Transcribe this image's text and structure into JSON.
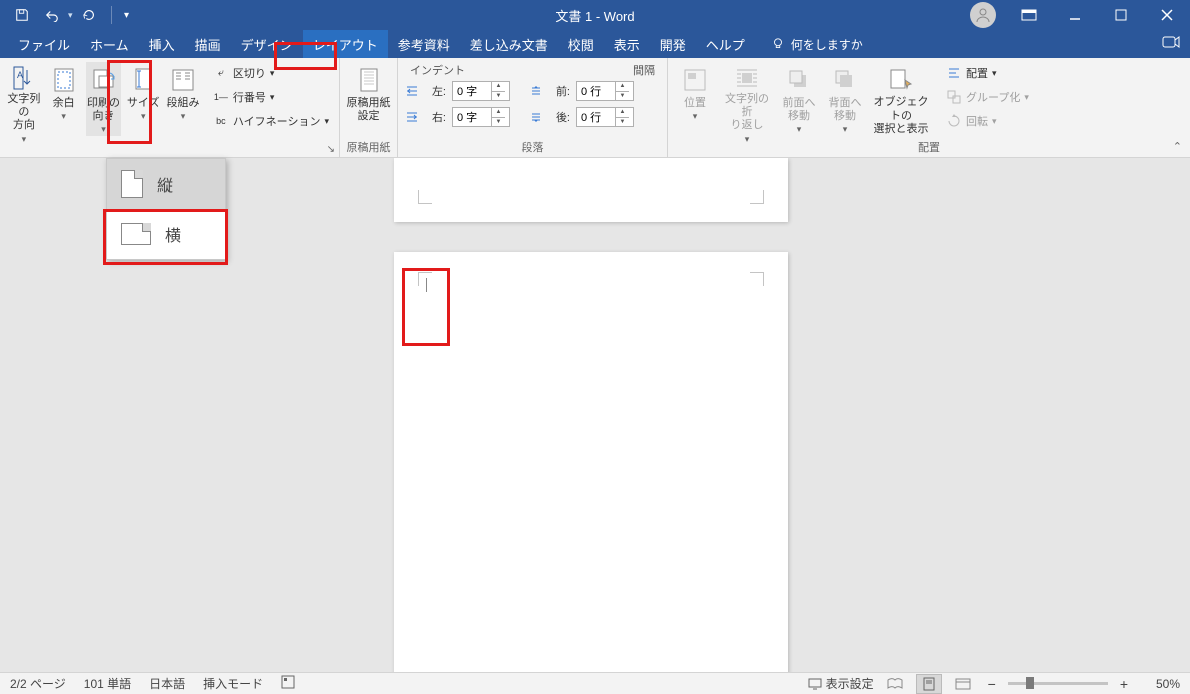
{
  "title": "文書 1  -  Word",
  "tabs": {
    "file": "ファイル",
    "home": "ホーム",
    "insert": "挿入",
    "draw": "描画",
    "design": "デザイン",
    "layout": "レイアウト",
    "references": "参考資料",
    "mailings": "差し込み文書",
    "review": "校閲",
    "view": "表示",
    "developer": "開発",
    "help": "ヘルプ"
  },
  "tell_me": "何をしますか",
  "ribbon": {
    "text_direction": "文字列の\n方向",
    "margins": "余白",
    "orientation": "印刷の\n向き",
    "size": "サイズ",
    "columns": "段組み",
    "breaks": "区切り",
    "line_numbers": "行番号",
    "hyphenation": "ハイフネーション",
    "manuscript": "原稿用紙\n設定",
    "group_manuscript": "原稿用紙",
    "indent_head": "インデント",
    "spacing_head": "間隔",
    "left": "左:",
    "right": "右:",
    "before": "前:",
    "after": "後:",
    "val_chars": "0 字",
    "val_lines": "0 行",
    "group_paragraph": "段落",
    "position": "位置",
    "wrap": "文字列の折\nり返し",
    "forward": "前面へ\n移動",
    "backward": "背面へ\n移動",
    "selection": "オブジェクトの\n選択と表示",
    "align": "配置",
    "group_obj": "グループ化",
    "rotate": "回転",
    "group_arrange": "配置"
  },
  "orientation_menu": {
    "portrait": "縦",
    "landscape": "横"
  },
  "status": {
    "page": "2/2 ページ",
    "words": "101 単語",
    "lang": "日本語",
    "mode": "挿入モード",
    "display": "表示設定",
    "zoom": "50%"
  }
}
